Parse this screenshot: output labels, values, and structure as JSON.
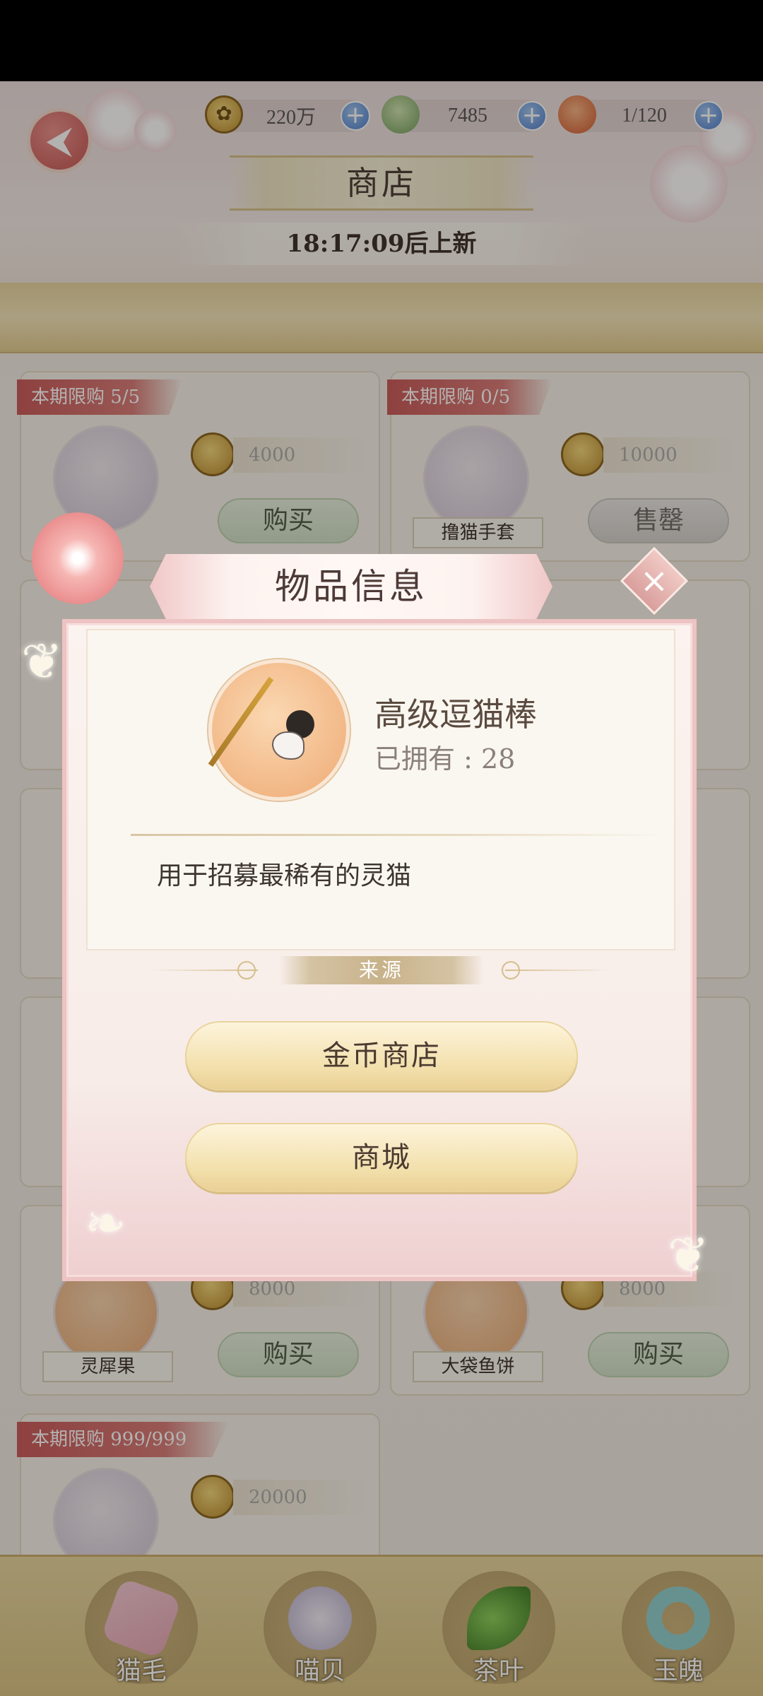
{
  "header": {
    "currencies": [
      {
        "name": "coin-icon",
        "value": "220万"
      },
      {
        "name": "jade-icon",
        "value": "7485"
      },
      {
        "name": "cake-icon",
        "value": "1/120"
      }
    ],
    "title": "商店",
    "refresh_text": "18:17:09后上新"
  },
  "cards": [
    {
      "limit": "本期限购 5/5",
      "name": "",
      "price": "4000",
      "button": "购买"
    },
    {
      "limit": "本期限购 0/5",
      "name": "撸猫手套",
      "price": "10000",
      "button": "售罄"
    },
    {
      "limit": "",
      "name": "灵犀果",
      "price": "8000",
      "button": "购买"
    },
    {
      "limit": "",
      "name": "大袋鱼饼",
      "price": "8000",
      "button": "购买"
    },
    {
      "limit": "本期限购 999/999",
      "name": "",
      "price": "20000",
      "button": ""
    }
  ],
  "bottom_nav": [
    {
      "label": "猫毛",
      "icon": "fur-icon"
    },
    {
      "label": "喵贝",
      "icon": "shell-icon"
    },
    {
      "label": "茶叶",
      "icon": "tea-leaf-icon"
    },
    {
      "label": "玉魄",
      "icon": "jade-ring-icon"
    }
  ],
  "modal": {
    "title": "物品信息",
    "item_name": "高级逗猫棒",
    "owned": "已拥有 : 28",
    "description": "用于招募最稀有的灵猫",
    "source_label": "来源",
    "source_buttons": [
      "金币商店",
      "商城"
    ]
  },
  "colors": {
    "accent_red": "#c9595a",
    "modal_border": "#edc3c3",
    "gold_button": "#f2dfaa"
  }
}
